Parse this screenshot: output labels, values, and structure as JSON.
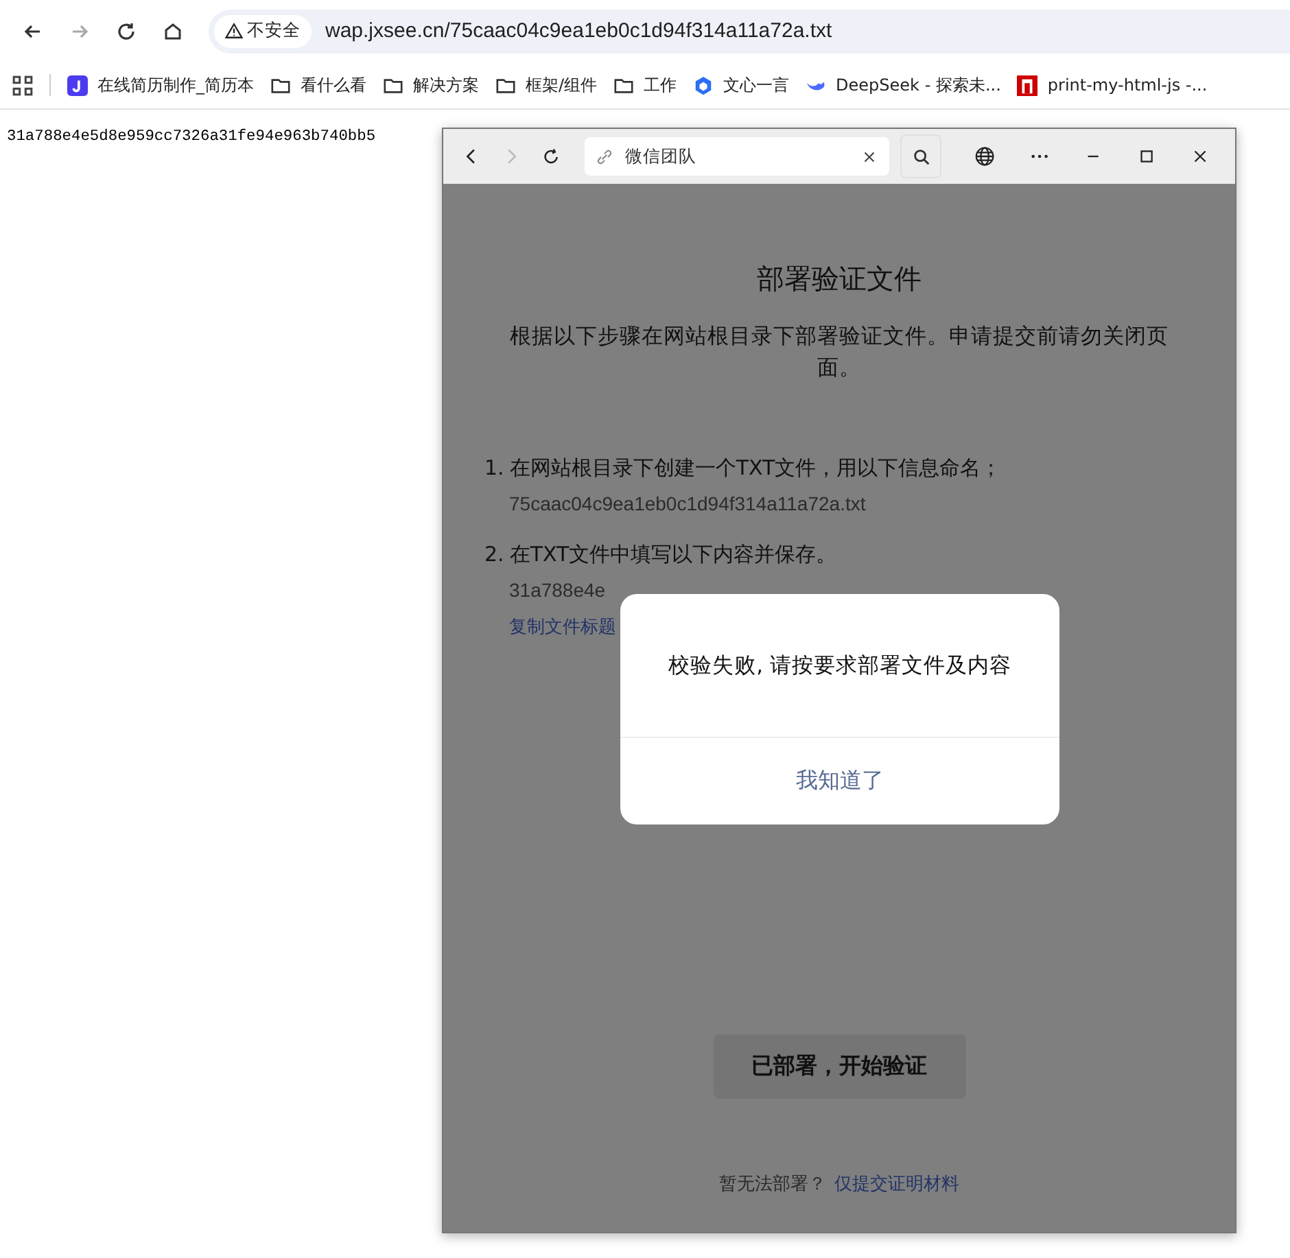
{
  "browser": {
    "security_label": "不安全",
    "url": "wap.jxsee.cn/75caac04c9ea1eb0c1d94f314a11a72a.txt"
  },
  "bookmarks": [
    {
      "kind": "app",
      "label": "在线简历制作_简历本"
    },
    {
      "kind": "folder",
      "label": "看什么看"
    },
    {
      "kind": "folder",
      "label": "解决方案"
    },
    {
      "kind": "folder",
      "label": "框架/组件"
    },
    {
      "kind": "folder",
      "label": "工作"
    },
    {
      "kind": "cube",
      "label": "文心一言"
    },
    {
      "kind": "whale",
      "label": "DeepSeek - 探索未..."
    },
    {
      "kind": "print",
      "label": "print-my-html-js -..."
    }
  ],
  "page_text": "31a788e4e5d8e959cc7326a31fe94e963b740bb5",
  "popup": {
    "address": "微信团队",
    "title": "部署验证文件",
    "intro": "根据以下步骤在网站根目录下部署验证文件。申请提交前请勿关闭页面。",
    "steps": [
      {
        "number": "1.",
        "text": "在网站根目录下创建一个TXT文件，用以下信息命名；",
        "detail": "75caac04c9ea1eb0c1d94f314a11a72a.txt"
      },
      {
        "number": "2.",
        "text": "在TXT文件中填写以下内容并保存。",
        "detail": "31a788e4e"
      }
    ],
    "copy_link": "复制文件标题",
    "verify_button": "已部署，开始验证",
    "footer_text": "暂无法部署？",
    "footer_link": "仅提交证明材料",
    "dialog": {
      "message": "校验失败, 请按要求部署文件及内容",
      "button": "我知道了"
    }
  }
}
